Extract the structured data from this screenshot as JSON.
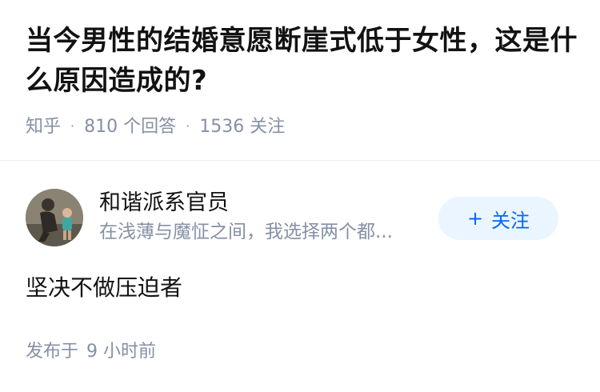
{
  "question": {
    "title": "当今男性的结婚意愿断崖式低于女性，这是什么原因造成的?",
    "source": "知乎",
    "answer_count": "810",
    "answer_label": "个回答",
    "follow_count": "1536",
    "follow_label": "关注"
  },
  "answer": {
    "author": {
      "avatar_icon": "user-avatar-photo",
      "name": "和谐派系官员",
      "bio": "在浅薄与魔怔之间，我选择两个都..."
    },
    "follow_button": {
      "icon": "plus-icon",
      "label": "关注"
    },
    "content": "坚决不做压迫者",
    "publish_prefix": "发布于",
    "publish_time": "9 小时前"
  },
  "colors": {
    "title": "#121212",
    "meta": "#8590a6",
    "accent": "#0066ff",
    "follow_bg": "#ebf5ff"
  }
}
